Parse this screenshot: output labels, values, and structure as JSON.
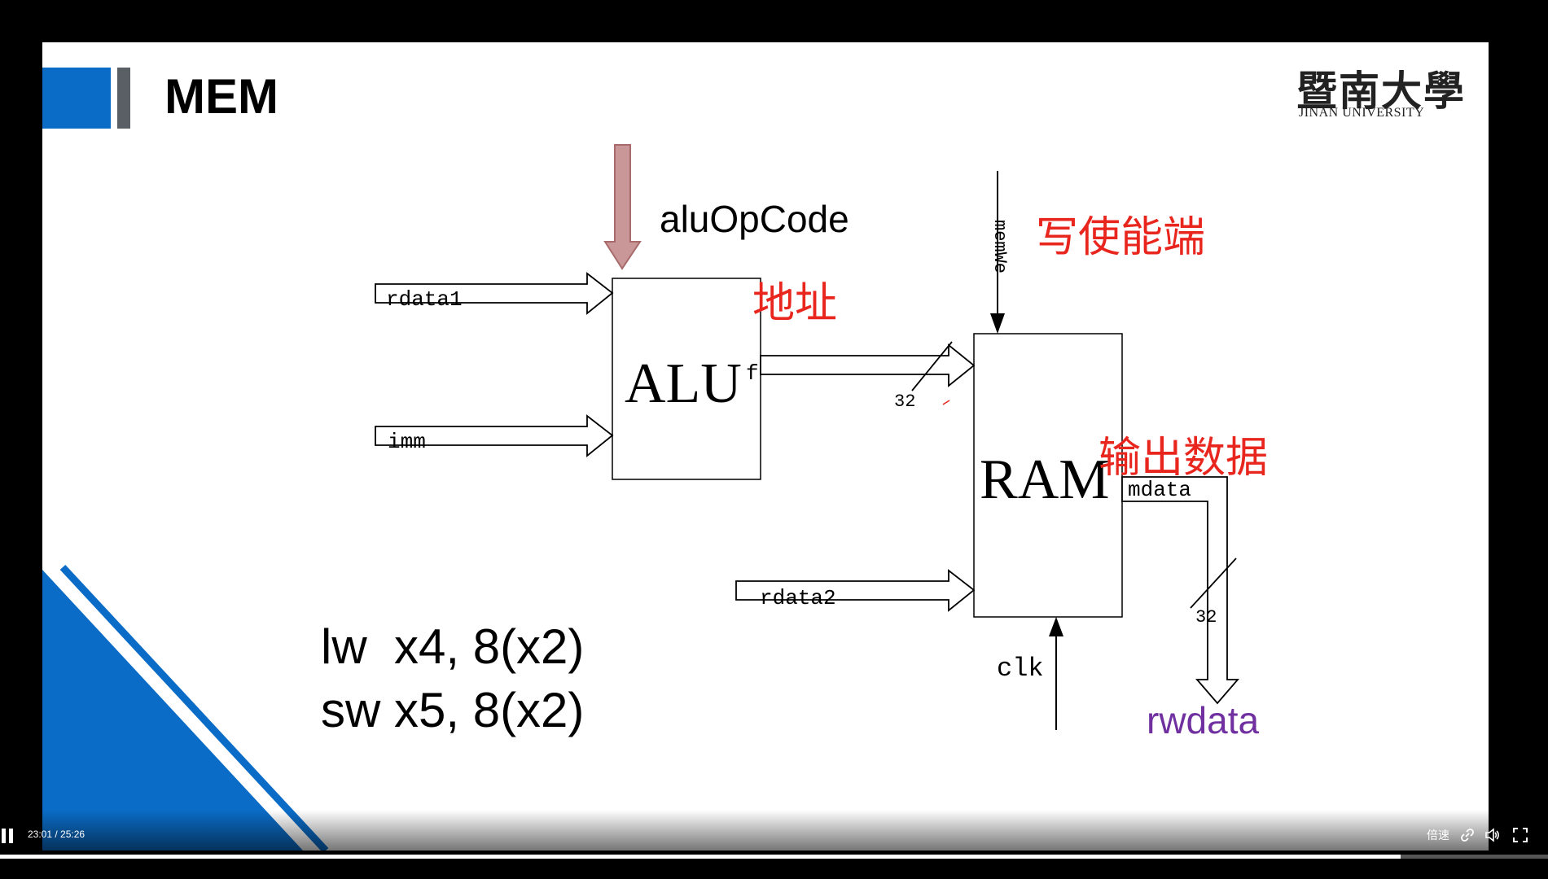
{
  "slide": {
    "title": "MEM",
    "logo_cn": "暨南大學",
    "logo_en": "JINAN UNIVERSITY"
  },
  "diagram": {
    "alu_label": "ALU",
    "ram_label": "RAM",
    "alu_opcode": "aluOpCode",
    "rdata1": "rdata1",
    "imm": "imm",
    "rdata2": "rdata2",
    "f": "f",
    "bus_width_f": "32",
    "bus_width_mdata": "32",
    "memwe": "memWe",
    "mdata": "mdata",
    "clk": "clk",
    "rwdata": "rwdata",
    "address_cn": "地址",
    "write_enable_cn": "写使能端",
    "output_data_cn": "输出数据"
  },
  "code": {
    "line1": "lw  x4, 8(x2)",
    "line2": "sw x5, 8(x2)"
  },
  "colors": {
    "accent_blue": "#0b6cc7",
    "annotation_red": "#e8261e",
    "rwdata_purple": "#7030a0",
    "opcode_arrow": "#c99797"
  },
  "player": {
    "timecode": "23:01 / 25:26",
    "speed_label": "倍速",
    "progress_fraction": 0.905,
    "icons": [
      "pause-icon",
      "link-icon",
      "volume-icon",
      "fullscreen-icon"
    ]
  }
}
